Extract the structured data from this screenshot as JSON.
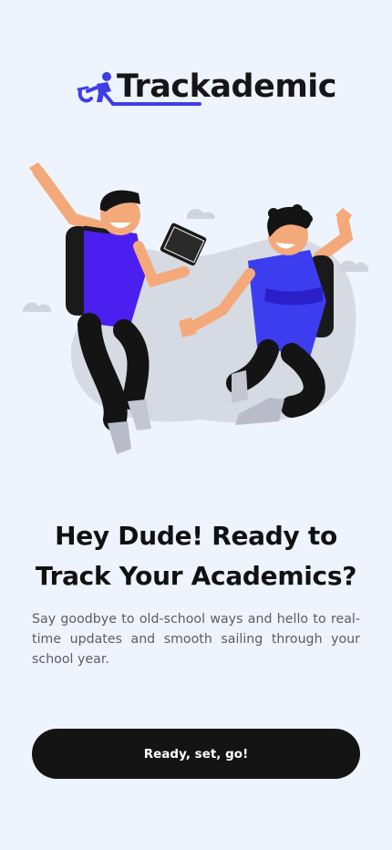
{
  "brand": {
    "name": "Trackademic",
    "logo_icon": "running-student-icon",
    "accent_color": "#3e3ee6"
  },
  "hero": {
    "illustration": "two-students-jumping-illustration"
  },
  "headline": "Hey Dude! Ready to Track Your Academics?",
  "subtext": "Say goodbye to old-school ways and hello to real-time updates and smooth sailing through your school year.",
  "cta": {
    "label": "Ready, set, go!",
    "background": "#141414"
  },
  "colors": {
    "background": "#eef4fe",
    "shirt": "#4b3ef5",
    "text": "#111113"
  }
}
